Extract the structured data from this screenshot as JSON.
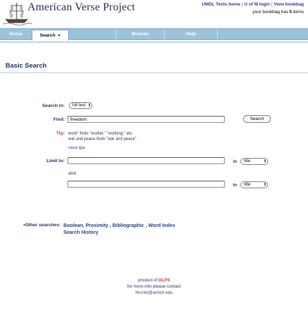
{
  "header": {
    "site_title": "American Verse Project",
    "top_links": [
      "UMDL Texts home",
      "U of M login",
      "View bookbag"
    ],
    "bookbag_prefix": "your bookbag has ",
    "bookbag_count": "0",
    "bookbag_suffix": " items",
    "logo_icon": "ship-logo-icon"
  },
  "nav": {
    "home": "Home",
    "search": "Search",
    "search_caret": "▼",
    "browse": "Browse",
    "help": "Help"
  },
  "page": {
    "title": "Basic Search"
  },
  "form": {
    "search_in_label": "Search in:",
    "search_in_value": "full text",
    "find_label": "Find:",
    "find_value": "freedom",
    "search_button": "Search",
    "tip_label": "Tip:",
    "tip_line1": "work* finds \"worker,\" \"working,\" etc.",
    "tip_line2": "war and peace finds \"war and peace\"",
    "more_tips": "more tips",
    "limit_label": "Limit to:",
    "limit_in_1": "in",
    "limit_field_1": "title",
    "and_label": "and",
    "limit_in_2": "in",
    "limit_field_2": "title",
    "other_label": "•Other searches:",
    "other_links": [
      "Boolean",
      "Proximity",
      "Bibliographic",
      "Word Index"
    ],
    "search_history": "Search History"
  },
  "footer": {
    "product_of": "product of ",
    "dlps": "DLPS",
    "contact_line": "for more info please contact",
    "email": "hti-info@umich.edu"
  },
  "colors": {
    "navbar": "#9bc3dc",
    "link_blue": "#2a3b8f",
    "label_navy": "#1c2c5e",
    "accent_red": "#c0392b"
  }
}
